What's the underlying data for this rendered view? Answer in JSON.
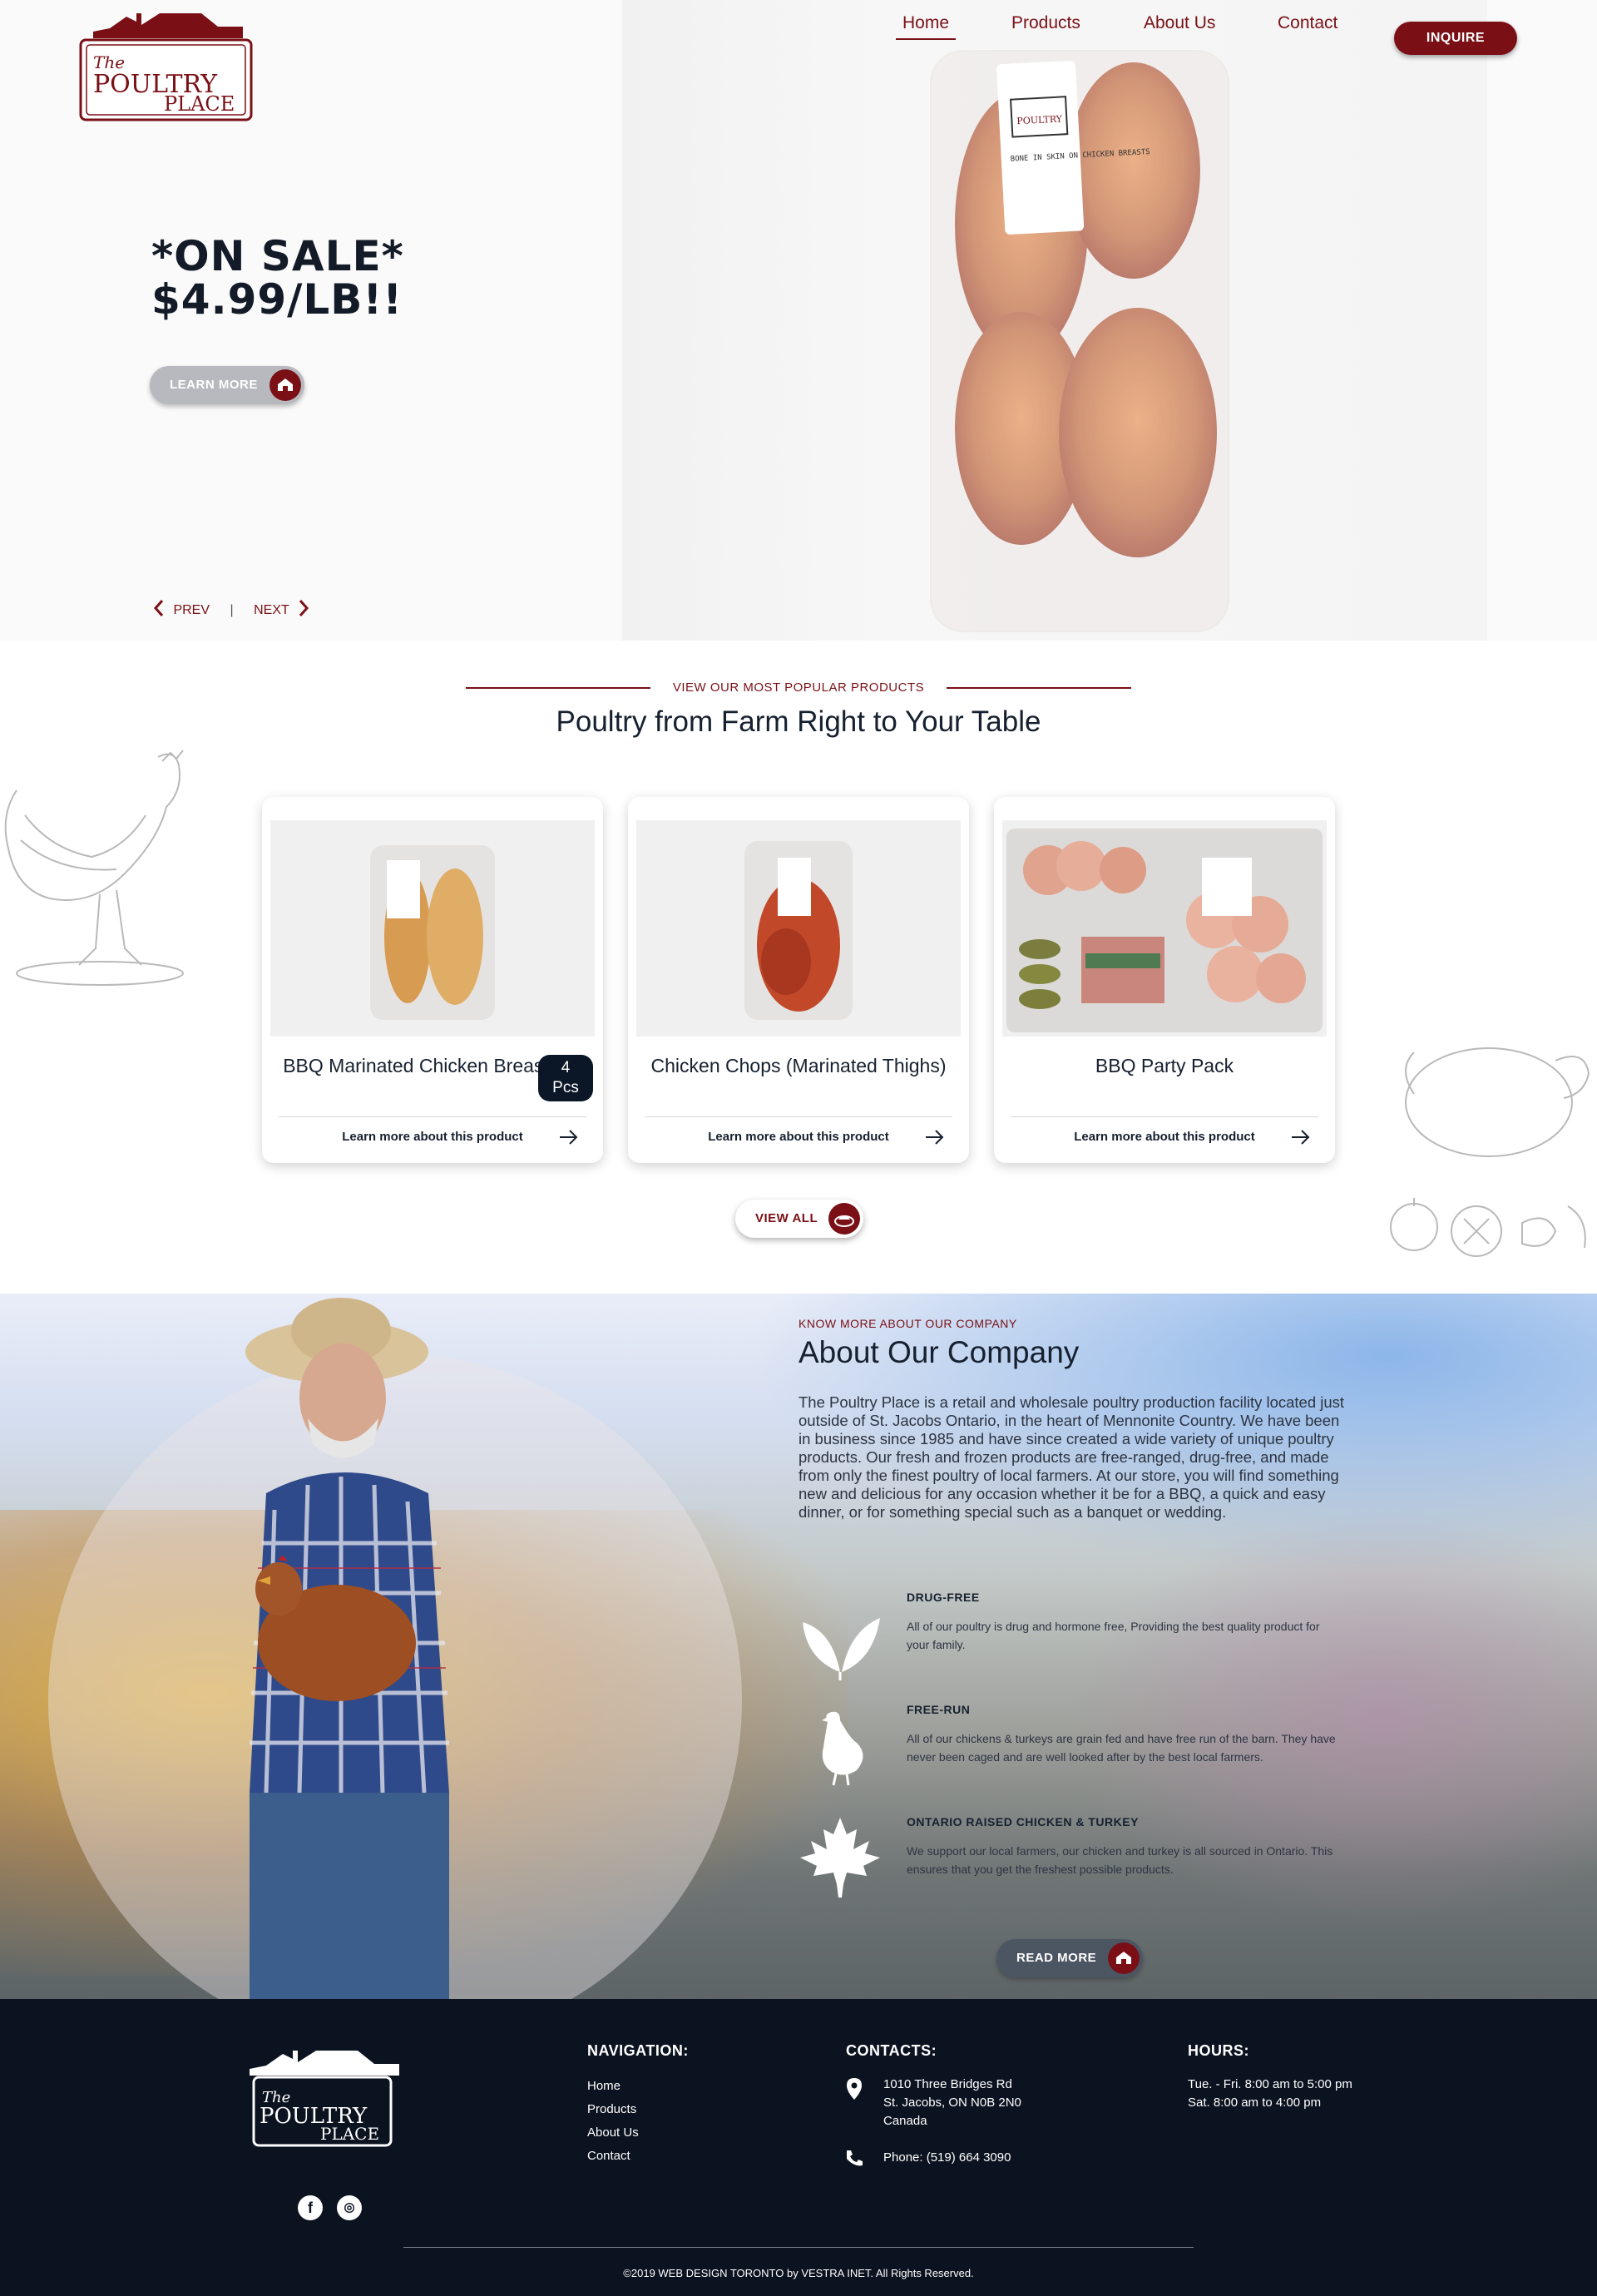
{
  "brand": {
    "logo_text_the": "The",
    "logo_text_poultry": "POULTRY",
    "logo_text_place": "PLACE",
    "primary_color": "#7a1016",
    "dark_color": "#0b1220"
  },
  "nav": {
    "items": [
      {
        "label": "Home",
        "active": true
      },
      {
        "label": "Products",
        "active": false
      },
      {
        "label": "About Us",
        "active": false
      },
      {
        "label": "Contact",
        "active": false
      }
    ],
    "inquire_label": "INQUIRE"
  },
  "hero": {
    "headline_line1": "*ON SALE*",
    "headline_line2": "$4.99/LB!!",
    "cta_label": "LEARN MORE",
    "prev_label": "PREV",
    "separator": "|",
    "next_label": "NEXT",
    "package_label": "BONE IN SKIN ON CHICKEN BREASTS"
  },
  "products": {
    "kicker": "VIEW OUR MOST POPULAR PRODUCTS",
    "title": "Poultry from Farm Right to Your Table",
    "items": [
      {
        "name": "BBQ Marinated Chicken Breast",
        "badge_line1": "4",
        "badge_line2": "Pcs",
        "link": "Learn more about this product"
      },
      {
        "name": "Chicken Chops (Marinated Thighs)",
        "link": "Learn more about this product"
      },
      {
        "name": "BBQ Party Pack",
        "link": "Learn more about this product"
      }
    ],
    "view_all_label": "VIEW ALL"
  },
  "about": {
    "kicker": "KNOW MORE ABOUT OUR COMPANY",
    "title": "About Our Company",
    "body": "The Poultry Place is a retail and wholesale poultry production facility located just outside of St. Jacobs Ontario, in the heart of Mennonite Country. We have been in business since 1985 and have since created a wide variety of unique poultry products. Our fresh and frozen products are free-ranged, drug-free, and made from only the finest poultry of local farmers. At our store, you will find something new and delicious for any occasion whether it be for a BBQ, a quick and easy dinner, or for something special such as a banquet or wedding.",
    "features": [
      {
        "icon": "leaf-icon",
        "title": "DRUG-FREE",
        "text": "All of our poultry is drug and hormone free, Providing the best quality product for your family."
      },
      {
        "icon": "chicken-icon",
        "title": "FREE-RUN",
        "text": "All of our chickens & turkeys are grain fed and have free run of the barn. They have never been caged and are well looked after by the best local farmers."
      },
      {
        "icon": "maple-leaf-icon",
        "title": "ONTARIO RAISED CHICKEN & TURKEY",
        "text": "We support our local farmers, our chicken and turkey is all sourced in Ontario. This ensures that you get the freshest possible products."
      }
    ],
    "cta_label": "READ MORE"
  },
  "footer": {
    "nav_heading": "NAVIGATION:",
    "nav_links": [
      "Home",
      "Products",
      "About Us",
      "Contact"
    ],
    "contacts_heading": "CONTACTS:",
    "address_line1": "1010 Three Bridges Rd",
    "address_line2": "St. Jacobs, ON N0B 2N0",
    "address_line3": "Canada",
    "phone": "Phone: (519) 664 3090",
    "hours_heading": "HOURS:",
    "hours_line1": "Tue. - Fri. 8:00 am to 5:00 pm",
    "hours_line2": "Sat. 8:00 am to 4:00 pm",
    "social": [
      "facebook-icon",
      "instagram-icon"
    ],
    "copyright": "©2019 WEB DESIGN TORONTO by VESTRA INET. All Rights Reserved."
  }
}
